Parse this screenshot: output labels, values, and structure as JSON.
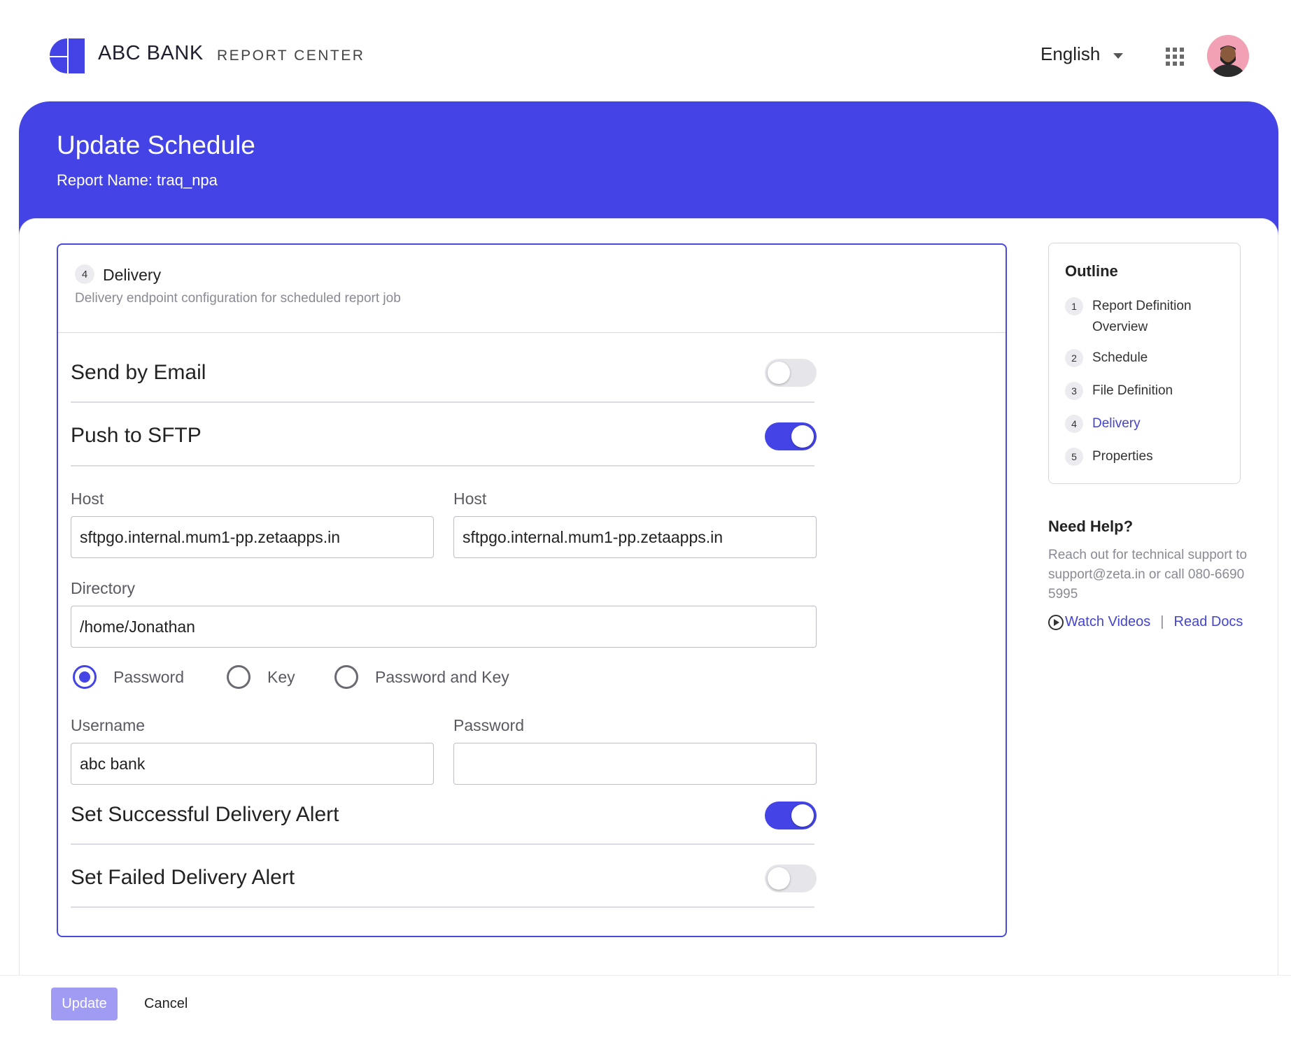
{
  "app": {
    "brand": "ABC BANK",
    "section": "REPORT CENTER",
    "language": "English",
    "accent_color": "#4444e6"
  },
  "header": {
    "title": "Update Schedule",
    "report_name": "Report Name: traq_npa"
  },
  "step": {
    "number": "4",
    "title": "Delivery",
    "description": "Delivery endpoint configuration for scheduled report job"
  },
  "delivery": {
    "send_by_email": {
      "label": "Send by Email",
      "enabled": false
    },
    "push_to_sftp": {
      "label": "Push to SFTP",
      "enabled": true
    },
    "host1": {
      "label": "Host",
      "value": "sftpgo.internal.mum1-pp.zetaapps.in"
    },
    "host2": {
      "label": "Host",
      "value": "sftpgo.internal.mum1-pp.zetaapps.in"
    },
    "directory": {
      "label": "Directory",
      "value": "/home/Jonathan"
    },
    "auth_options": [
      {
        "label": "Password",
        "selected": true
      },
      {
        "label": "Key",
        "selected": false
      },
      {
        "label": "Password and Key",
        "selected": false
      }
    ],
    "username": {
      "label": "Username",
      "value": "abc bank"
    },
    "password": {
      "label": "Password",
      "value": ""
    },
    "success_alert": {
      "label": "Set Successful Delivery Alert",
      "enabled": true
    },
    "failed_alert": {
      "label": "Set Failed Delivery Alert",
      "enabled": false
    }
  },
  "outline": {
    "title": "Outline",
    "items": [
      {
        "num": "1",
        "label": "Report Definition Overview",
        "active": false
      },
      {
        "num": "2",
        "label": "Schedule",
        "active": false
      },
      {
        "num": "3",
        "label": "File Definition",
        "active": false
      },
      {
        "num": "4",
        "label": "Delivery",
        "active": true
      },
      {
        "num": "5",
        "label": "Properties",
        "active": false
      }
    ]
  },
  "help": {
    "title": "Need Help?",
    "text": "Reach out for technical support to support@zeta.in or call 080-6690 5995",
    "watch_videos": "Watch Videos",
    "separator": "|",
    "read_docs": "Read Docs",
    "video_icon": "play-circle-icon"
  },
  "footer": {
    "update_label": "Update",
    "cancel_label": "Cancel"
  }
}
